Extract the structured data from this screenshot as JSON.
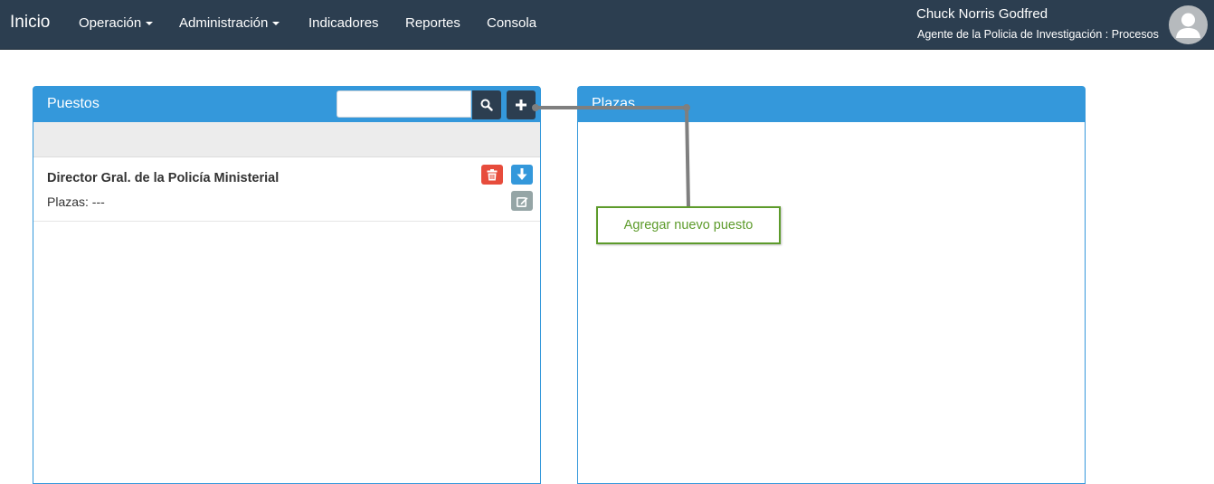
{
  "navbar": {
    "brand": "Inicio",
    "items": [
      {
        "label": "Operación",
        "dropdown": true
      },
      {
        "label": "Administración",
        "dropdown": true
      },
      {
        "label": "Indicadores",
        "dropdown": false
      },
      {
        "label": "Reportes",
        "dropdown": false
      },
      {
        "label": "Consola",
        "dropdown": false
      }
    ],
    "user": {
      "name": "Chuck Norris Godfred",
      "role": "Agente de la Policia de Investigación : Procesos",
      "avatar_icon": "user-icon"
    }
  },
  "puestos_panel": {
    "title": "Puestos",
    "search": {
      "placeholder": "",
      "value": ""
    },
    "search_button_icon": "search-icon",
    "add_button_icon": "plus-icon",
    "items": [
      {
        "title": "Director Gral. de la Policía Ministerial",
        "subtitle": "Plazas: ---",
        "actions": [
          "trash-icon",
          "download-icon",
          "edit-icon"
        ]
      }
    ]
  },
  "plazas_panel": {
    "title": "Plazas"
  },
  "tooltip": {
    "text": "Agregar nuevo puesto"
  },
  "colors": {
    "navbar": "#2c3e50",
    "panel_primary": "#3498db",
    "danger": "#e74c3c",
    "info": "#3498db",
    "muted": "#95a5a6",
    "tooltip_green": "#5d9b2b"
  }
}
